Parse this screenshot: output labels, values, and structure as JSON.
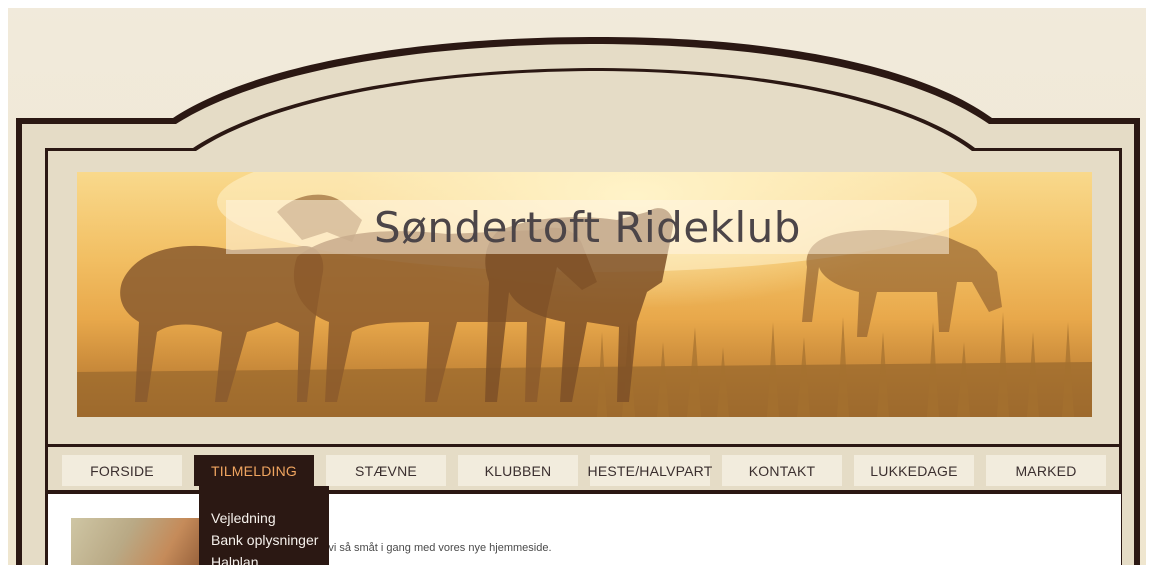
{
  "site": {
    "title": "Søndertoft Rideklub"
  },
  "nav": {
    "items": [
      {
        "label": "FORSIDE"
      },
      {
        "label": "TILMELDING"
      },
      {
        "label": "STÆVNE"
      },
      {
        "label": "KLUBBEN"
      },
      {
        "label": "HESTE/HALVPART"
      },
      {
        "label": "KONTAKT"
      },
      {
        "label": "LUKKEDAGE"
      },
      {
        "label": "MARKED"
      }
    ],
    "active": "TILMELDING"
  },
  "dropdown": {
    "items": [
      {
        "label": "Vejledning"
      },
      {
        "label": "Bank oplysninger"
      },
      {
        "label": "Halplan"
      }
    ]
  },
  "content": {
    "intro_text": "Så er vi så småt i gang med vores nye hjemmeside."
  },
  "colors": {
    "frame_dark": "#2b1813",
    "frame_cream": "#e5dcc6",
    "nav_button": "#f2ecdd",
    "nav_active_text": "#f0a560"
  }
}
